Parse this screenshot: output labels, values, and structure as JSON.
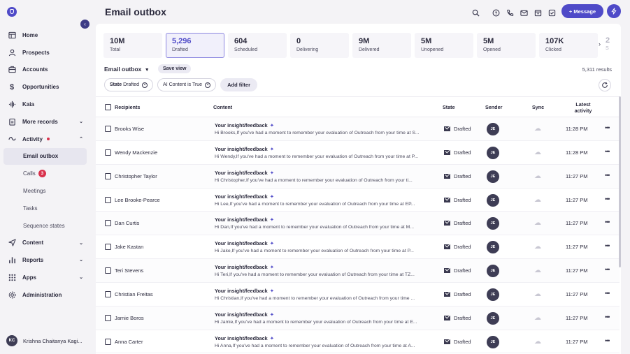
{
  "page_title": "Email outbox",
  "sidebar": {
    "collapse_icon": "chevron-left",
    "items": [
      {
        "label": "Home",
        "icon": "home"
      },
      {
        "label": "Prospects",
        "icon": "person"
      },
      {
        "label": "Accounts",
        "icon": "briefcase"
      },
      {
        "label": "Opportunities",
        "icon": "dollar"
      },
      {
        "label": "Kaia",
        "icon": "waveform"
      },
      {
        "label": "More records",
        "icon": "clipboard",
        "has_chevron": true
      },
      {
        "label": "Activity",
        "icon": "lightning",
        "has_chevron": true,
        "has_alert_dot": true
      },
      {
        "label": "Content",
        "icon": "send",
        "has_chevron": true
      },
      {
        "label": "Reports",
        "icon": "bar-chart",
        "has_chevron": true
      },
      {
        "label": "Apps",
        "icon": "grid",
        "has_chevron": true
      },
      {
        "label": "Administration",
        "icon": "gear"
      }
    ],
    "activity_sub": [
      {
        "label": "Email outbox",
        "active": true
      },
      {
        "label": "Calls",
        "badge": "3"
      },
      {
        "label": "Meetings"
      },
      {
        "label": "Tasks"
      },
      {
        "label": "Sequence states"
      }
    ],
    "user": {
      "initials": "KC",
      "name": "Krishna Chaitanya Kagi..."
    }
  },
  "header": {
    "icons": [
      "search-icon",
      "help-icon",
      "phone-icon",
      "mail-icon",
      "calendar-icon",
      "checkbox-icon"
    ],
    "message_button": "+ Message",
    "bolt_icon": "bolt-icon"
  },
  "stats": [
    {
      "value": "10M",
      "label": "Total"
    },
    {
      "value": "5,296",
      "label": "Drafted",
      "active": true
    },
    {
      "value": "604",
      "label": "Scheduled"
    },
    {
      "value": "0",
      "label": "Delivering"
    },
    {
      "value": "9M",
      "label": "Delivered"
    },
    {
      "value": "5M",
      "label": "Unopened"
    },
    {
      "value": "5M",
      "label": "Opened"
    },
    {
      "value": "107K",
      "label": "Clicked"
    },
    {
      "value": "2",
      "label": "S"
    }
  ],
  "view": {
    "title": "Email outbox",
    "save_view": "Save view",
    "results": "5,311 results"
  },
  "filters": [
    {
      "label": "State",
      "value": "Drafted"
    },
    {
      "label": "AI Content is True",
      "value": ""
    }
  ],
  "add_filter": "Add filter",
  "table": {
    "headers": {
      "recipients": "Recipients",
      "content": "Content",
      "state": "State",
      "sender": "Sender",
      "sync": "Sync",
      "latest": "Latest activity"
    },
    "rows": [
      {
        "recipient": "Brooks Wise",
        "subject": "Your insight/feedback",
        "snippet": "Hi Brooks,If you've had a moment to remember your evaluation of Outreach from your time at S...",
        "state": "Drafted",
        "sender": "JE",
        "time": "11:28 PM"
      },
      {
        "recipient": "Wendy Mackenzie",
        "subject": "Your insight/feedback",
        "snippet": "Hi Wendy,If you've had a moment to remember your evaluation of Outreach from your time at P...",
        "state": "Drafted",
        "sender": "JE",
        "time": "11:28 PM"
      },
      {
        "recipient": "Christopher Taylor",
        "subject": "Your insight/feedback",
        "snippet": "Hi Christopher,If you've had a moment to remember your evaluation of Outreach from your ti...",
        "state": "Drafted",
        "sender": "JE",
        "time": "11:27 PM"
      },
      {
        "recipient": "Lee Brooke-Pearce",
        "subject": "Your insight/feedback",
        "snippet": "Hi Lee,If you've had a moment to remember your evaluation of Outreach from your time at EP...",
        "state": "Drafted",
        "sender": "JE",
        "time": "11:27 PM"
      },
      {
        "recipient": "Dan Curtis",
        "subject": "Your insight/feedback",
        "snippet": "Hi Dan,If you've had a moment to remember your evaluation of Outreach from your time at M...",
        "state": "Drafted",
        "sender": "JE",
        "time": "11:27 PM"
      },
      {
        "recipient": "Jake Kastan",
        "subject": "Your insight/feedback",
        "snippet": "Hi Jake,If you've had a moment to remember your evaluation of Outreach from your time at P...",
        "state": "Drafted",
        "sender": "JE",
        "time": "11:27 PM"
      },
      {
        "recipient": "Teri Stevens",
        "subject": "Your insight/feedback",
        "snippet": "Hi Teri,If you've had a moment to remember your evaluation of Outreach from your time at TZ...",
        "state": "Drafted",
        "sender": "JE",
        "time": "11:27 PM"
      },
      {
        "recipient": "Christian Freitas",
        "subject": "Your insight/feedback",
        "snippet": "Hi Christian,If you've had a moment to remember your evaluation of Outreach from your time ...",
        "state": "Drafted",
        "sender": "JE",
        "time": "11:27 PM"
      },
      {
        "recipient": "Jamie Boros",
        "subject": "Your insight/feedback",
        "snippet": "Hi Jamie,If you've had a moment to remember your evaluation of Outreach from your time at E...",
        "state": "Drafted",
        "sender": "JE",
        "time": "11:27 PM"
      },
      {
        "recipient": "Anna Carter",
        "subject": "Your insight/feedback",
        "snippet": "Hi Anna,If you've had a moment to remember your evaluation of Outreach from your time at A...",
        "state": "Drafted",
        "sender": "JE",
        "time": "11:27 PM"
      }
    ]
  }
}
